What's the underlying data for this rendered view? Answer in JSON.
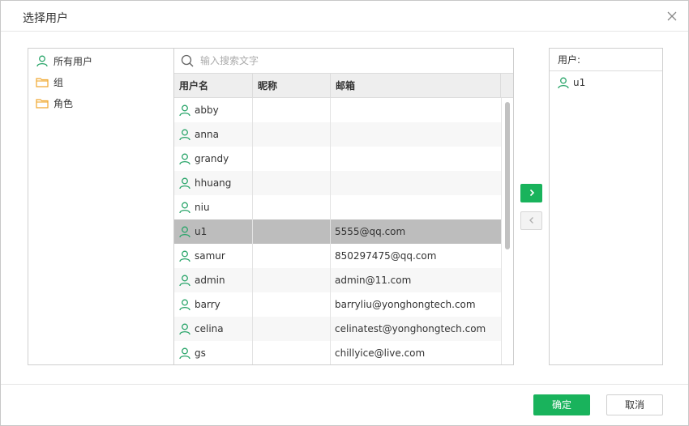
{
  "dialog": {
    "title": "选择用户",
    "close_icon": "close-icon"
  },
  "tree": {
    "items": [
      {
        "label": "所有用户",
        "icon": "user-icon"
      },
      {
        "label": "组",
        "icon": "folder-icon"
      },
      {
        "label": "角色",
        "icon": "folder-icon"
      }
    ]
  },
  "search": {
    "placeholder": "输入搜索文字",
    "value": ""
  },
  "table": {
    "columns": [
      "用户名",
      "昵称",
      "邮箱"
    ],
    "rows": [
      {
        "username": "abby",
        "nickname": "",
        "email": ""
      },
      {
        "username": "anna",
        "nickname": "",
        "email": ""
      },
      {
        "username": "grandy",
        "nickname": "",
        "email": ""
      },
      {
        "username": "hhuang",
        "nickname": "",
        "email": ""
      },
      {
        "username": "niu",
        "nickname": "",
        "email": ""
      },
      {
        "username": "u1",
        "nickname": "",
        "email": "5555@qq.com",
        "selected": true
      },
      {
        "username": "samur",
        "nickname": "",
        "email": "850297475@qq.com"
      },
      {
        "username": "admin",
        "nickname": "",
        "email": "admin@11.com"
      },
      {
        "username": "barry",
        "nickname": "",
        "email": "barryliu@yonghongtech.com"
      },
      {
        "username": "celina",
        "nickname": "",
        "email": "celinatest@yonghongtech.com"
      },
      {
        "username": "gs",
        "nickname": "",
        "email": "chillyice@live.com"
      }
    ]
  },
  "transfer": {
    "move_right_icon": "chevron-right-icon",
    "move_left_icon": "chevron-left-icon"
  },
  "selected": {
    "header": "用户:",
    "items": [
      {
        "label": "u1",
        "icon": "user-icon"
      }
    ]
  },
  "footer": {
    "ok_label": "确定",
    "cancel_label": "取消"
  },
  "colors": {
    "accent": "#19b35c",
    "user_icon": "#2aa56a",
    "folder_icon": "#f0a830",
    "selected_row": "#bdbdbd"
  }
}
